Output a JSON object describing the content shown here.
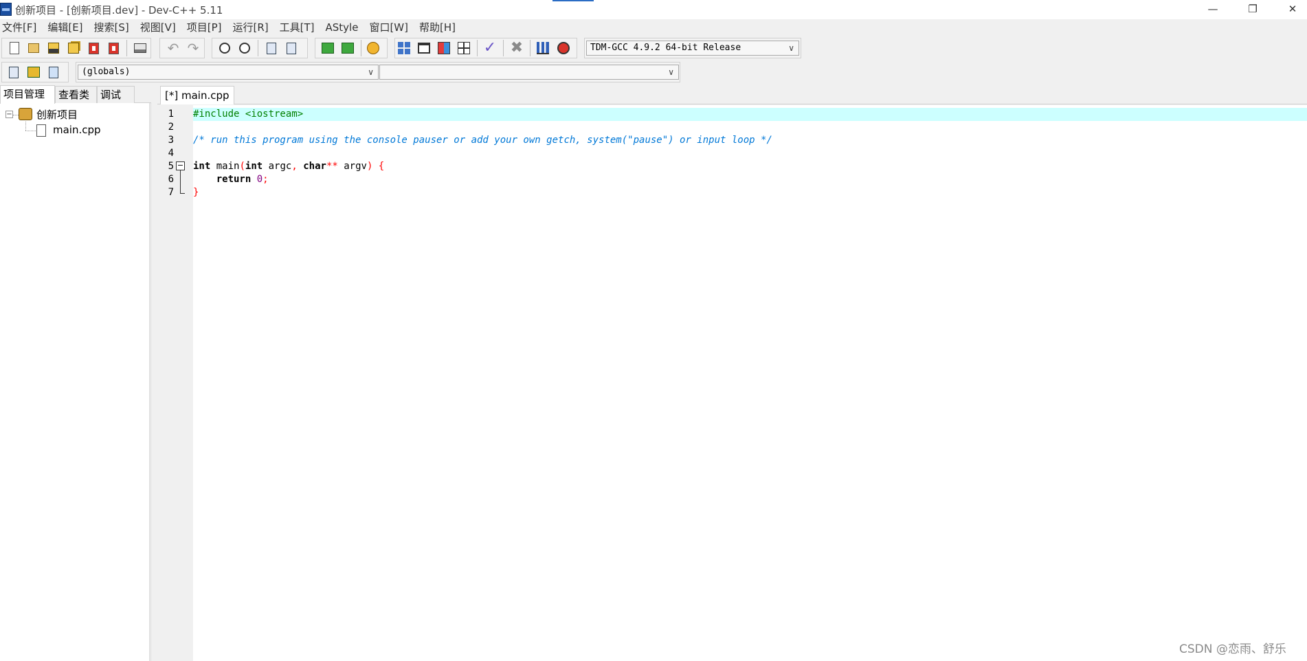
{
  "window": {
    "title": "创新项目 - [创新项目.dev] - Dev-C++ 5.11",
    "controls": {
      "minimize": "—",
      "maximize": "❐",
      "close": "✕"
    }
  },
  "menu": [
    "文件[F]",
    "编辑[E]",
    "搜索[S]",
    "视图[V]",
    "项目[P]",
    "运行[R]",
    "工具[T]",
    "AStyle",
    "窗口[W]",
    "帮助[H]"
  ],
  "toolbar": {
    "compiler_select": "TDM-GCC 4.9.2 64-bit Release",
    "scope_select": "(globals)",
    "member_select": ""
  },
  "left_panel": {
    "tabs": [
      "项目管理",
      "查看类",
      "调试"
    ],
    "active_tab": "项目管理",
    "tree": {
      "project_name": "创新项目",
      "expander": "−",
      "files": [
        "main.cpp"
      ]
    }
  },
  "editor": {
    "tab_label": "[*] main.cpp",
    "line_numbers": [
      "1",
      "2",
      "3",
      "4",
      "5",
      "6",
      "7"
    ],
    "fold_marker": "−",
    "lines": {
      "l1": "#include <iostream>",
      "l3": "/* run this program using the console pauser or add your own getch, system(\"pause\") or input loop */",
      "l5": {
        "kw_int": "int",
        "main": " main",
        "paren_open": "(",
        "kw_int2": "int",
        "argc": " argc",
        "comma": ",",
        "kw_char": " char",
        "stars": "**",
        "argv": " argv",
        "close": ") {"
      },
      "l6": {
        "indent": "    ",
        "kw_return": "return",
        "space": " ",
        "num": "0",
        "semi": ";"
      },
      "l7": "}"
    }
  },
  "watermark": "CSDN @恋雨、舒乐"
}
